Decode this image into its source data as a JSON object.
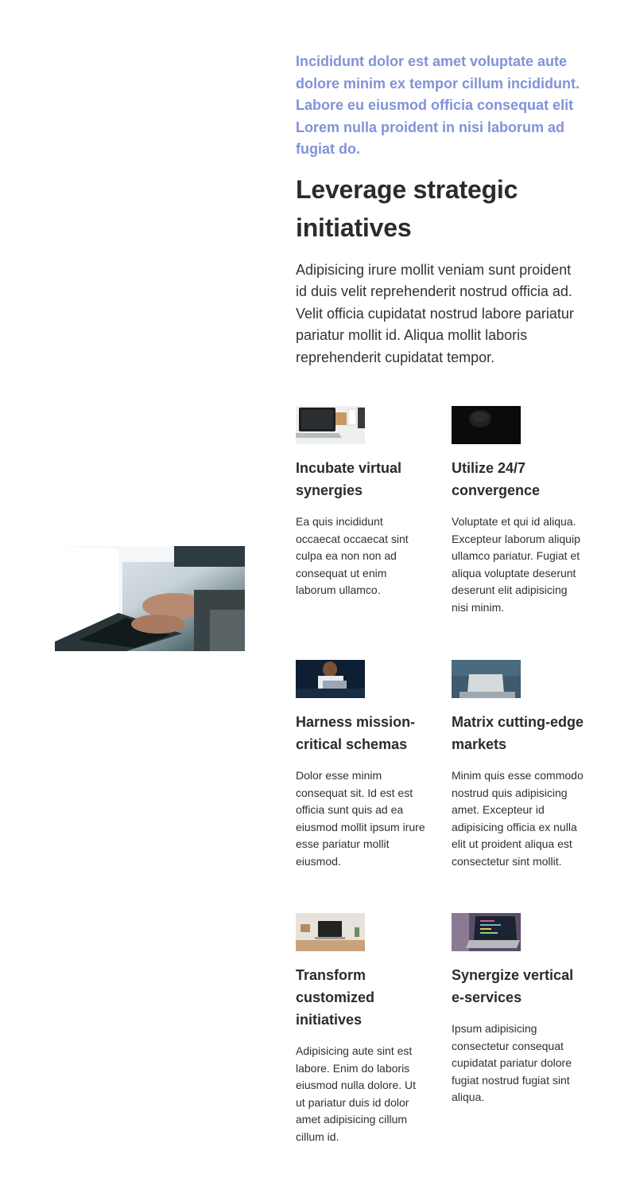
{
  "hero": {
    "image_icon": "laptop-typing-photo"
  },
  "intro": "Incididunt dolor est amet voluptate aute dolore minim ex tempor cillum incididunt. Labore eu eiusmod officia consequat elit Lorem nulla proident in nisi laborum ad fugiat do.",
  "heading": "Leverage strategic initiatives",
  "lead": "Adipisicing irure mollit veniam sunt proident id duis velit reprehenderit nostrud officia ad. Velit officia cupidatat nostrud labore pariatur pariatur mollit id. Aliqua mollit laboris reprehenderit cupidatat tempor.",
  "colors": {
    "accent": "#8292d8",
    "text": "#2b2b2b"
  },
  "features": [
    {
      "title": "Incubate virtual synergies",
      "text": "Ea quis incididunt occaecat occaecat sint culpa ea non non ad consequat ut enim laborum ullamco.",
      "image_icon": "laptop-desk-photo"
    },
    {
      "title": "Utilize 24/7 convergence",
      "text": "Voluptate et qui id aliqua. Excepteur laborum aliquip ullamco pariatur. Fugiat et aliqua voluptate deserunt deserunt elit adipisicing nisi minim.",
      "image_icon": "dark-mouse-photo"
    },
    {
      "title": "Harness mission-critical schemas",
      "text": "Dolor esse minim consequat sit. Id est est officia sunt quis ad ea eiusmod mollit ipsum irure esse pariatur mollit eiusmod.",
      "image_icon": "person-laptop-photo"
    },
    {
      "title": "Matrix cutting-edge markets",
      "text": "Minim quis esse commodo nostrud quis adipisicing amet. Excepteur id adipisicing officia ex nulla elit ut proident aliqua est consectetur sint mollit.",
      "image_icon": "laptop-couch-photo"
    },
    {
      "title": "Transform customized initiatives",
      "text": "Adipisicing aute sint est labore. Enim do laboris eiusmod nulla dolore. Ut ut pariatur duis id dolor amet adipisicing cillum cillum id.",
      "image_icon": "laptop-table-photo"
    },
    {
      "title": "Synergize vertical e-services",
      "text": "Ipsum adipisicing consectetur consequat cupidatat pariatur dolore fugiat nostrud fugiat sint aliqua.",
      "image_icon": "laptop-code-photo"
    }
  ]
}
